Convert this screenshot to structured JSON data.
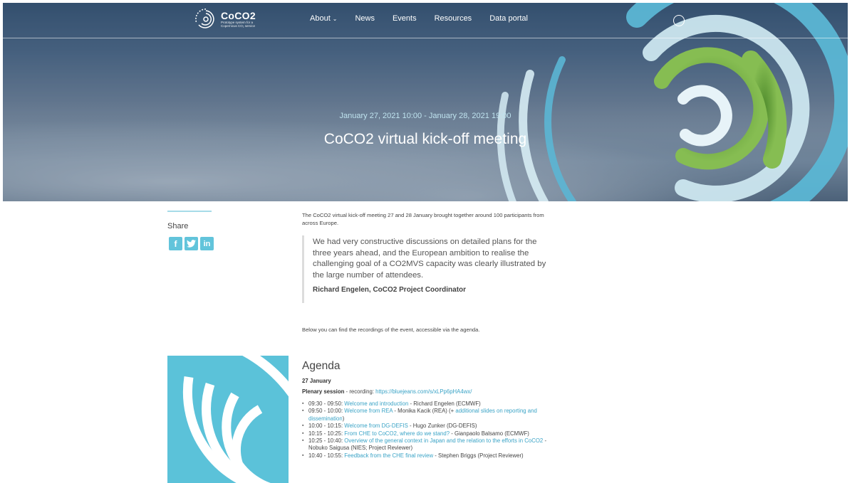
{
  "brand": {
    "name": "CoCO2",
    "tagline": "Prototype system for a Copernicus CO₂ service"
  },
  "nav": {
    "items": [
      "About",
      "News",
      "Events",
      "Resources",
      "Data portal"
    ],
    "search_icon": "search-icon"
  },
  "hero": {
    "date": "January 27, 2021 10:00 - January 28, 2021 19:00",
    "title": "CoCO2 virtual kick-off meeting"
  },
  "share": {
    "label": "Share",
    "icons": [
      "facebook-icon",
      "twitter-icon",
      "linkedin-icon"
    ]
  },
  "article": {
    "intro": "The CoCO2 virtual kick-off meeting 27 and 28 January brought together around 100 participants from across Europe.",
    "quote": "We had very constructive discussions on detailed plans for the three years ahead, and the European ambition to realise the challenging goal of a CO2MVS capacity was clearly illustrated by the large number of attendees.",
    "quote_author": "Richard Engelen, CoCO2 Project Coordinator",
    "recordings_text": "Below you can find the recordings of the event, accessible via the agenda."
  },
  "agenda": {
    "title": "Agenda",
    "day": "27 January",
    "plenary_label": "Plenary session",
    "plenary_text": " - recording: ",
    "plenary_link": "https://bluejeans.com/s/xLPp6pHA4wx/",
    "items": [
      {
        "time": "09:30 - 09:50: ",
        "link": "Welcome and introduction",
        "text": " - Richard Engelen (ECMWF)"
      },
      {
        "time": "09:50 - 10:00: ",
        "link": "Welcome from REA",
        "text": " - Monika Kacik (REA) (+ ",
        "link2": "additional slides on reporting and dissemination",
        "text2": ")"
      },
      {
        "time": "10:00 - 10:15: ",
        "link": "Welcome from DG-DEFIS",
        "text": " - Hugo Zunker (DG-DEFIS)"
      },
      {
        "time": "10:15 - 10:25: ",
        "link": "From CHE to CoCO2, where do we stand?",
        "text": " - Gianpaolo Balsamo (ECMWF)"
      },
      {
        "time": "10:25 - 10:40: ",
        "link": "Overview of the general context in Japan and the relation to the efforts in CoCO2",
        "text": " -  Nobuko Saigusa (NIES; Project Reviewer)"
      },
      {
        "time": "10:40 - 10:55: ",
        "link": "Feedback from the CHE final review",
        "text": " - Stephen Briggs (Project Reviewer)"
      }
    ]
  }
}
